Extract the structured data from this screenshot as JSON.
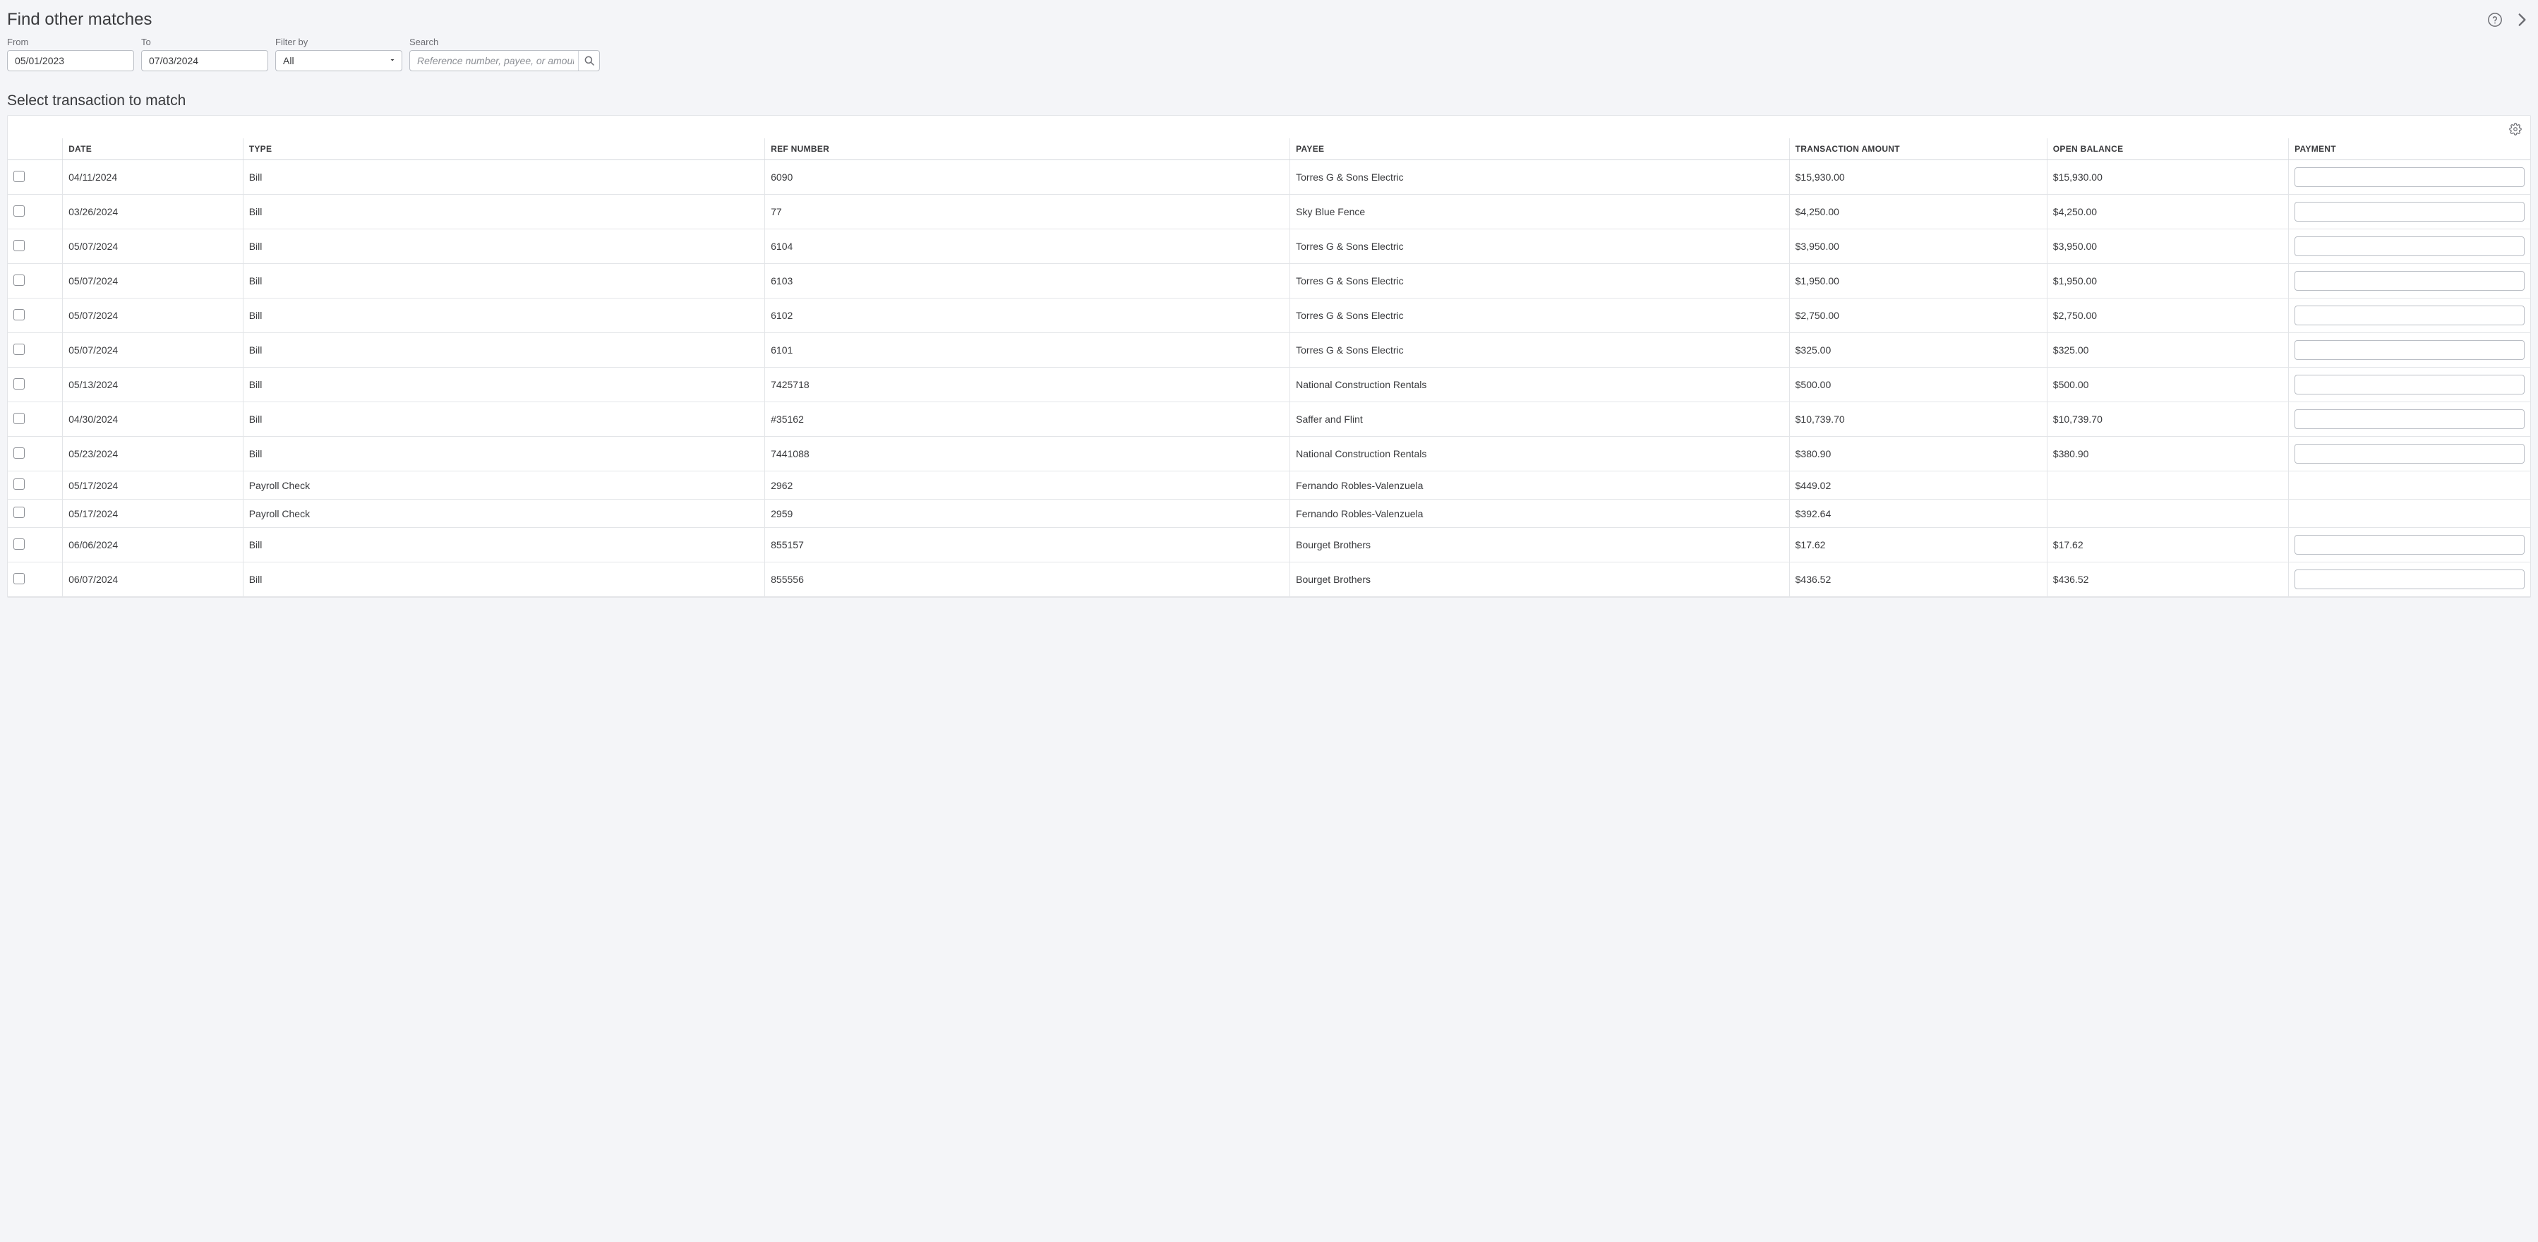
{
  "header": {
    "title": "Find other matches"
  },
  "filters": {
    "from_label": "From",
    "from_value": "05/01/2023",
    "to_label": "To",
    "to_value": "07/03/2024",
    "filter_by_label": "Filter by",
    "filter_by_value": "All",
    "search_label": "Search",
    "search_placeholder": "Reference number, payee, or amount"
  },
  "section_title": "Select transaction to match",
  "columns": {
    "date": "DATE",
    "type": "TYPE",
    "ref": "REF NUMBER",
    "payee": "PAYEE",
    "amount": "TRANSACTION AMOUNT",
    "balance": "OPEN BALANCE",
    "payment": "PAYMENT"
  },
  "rows": [
    {
      "date": "04/11/2024",
      "type": "Bill",
      "ref": "6090",
      "payee": "Torres G & Sons Electric",
      "amount": "$15,930.00",
      "balance": "$15,930.00",
      "has_payment_input": true
    },
    {
      "date": "03/26/2024",
      "type": "Bill",
      "ref": "77",
      "payee": "Sky Blue Fence",
      "amount": "$4,250.00",
      "balance": "$4,250.00",
      "has_payment_input": true
    },
    {
      "date": "05/07/2024",
      "type": "Bill",
      "ref": "6104",
      "payee": "Torres G & Sons Electric",
      "amount": "$3,950.00",
      "balance": "$3,950.00",
      "has_payment_input": true
    },
    {
      "date": "05/07/2024",
      "type": "Bill",
      "ref": "6103",
      "payee": "Torres G & Sons Electric",
      "amount": "$1,950.00",
      "balance": "$1,950.00",
      "has_payment_input": true
    },
    {
      "date": "05/07/2024",
      "type": "Bill",
      "ref": "6102",
      "payee": "Torres G & Sons Electric",
      "amount": "$2,750.00",
      "balance": "$2,750.00",
      "has_payment_input": true
    },
    {
      "date": "05/07/2024",
      "type": "Bill",
      "ref": "6101",
      "payee": "Torres G & Sons Electric",
      "amount": "$325.00",
      "balance": "$325.00",
      "has_payment_input": true
    },
    {
      "date": "05/13/2024",
      "type": "Bill",
      "ref": "7425718",
      "payee": "National Construction Rentals",
      "amount": "$500.00",
      "balance": "$500.00",
      "has_payment_input": true
    },
    {
      "date": "04/30/2024",
      "type": "Bill",
      "ref": "#35162",
      "payee": "Saffer and Flint",
      "amount": "$10,739.70",
      "balance": "$10,739.70",
      "has_payment_input": true
    },
    {
      "date": "05/23/2024",
      "type": "Bill",
      "ref": "7441088",
      "payee": "National Construction Rentals",
      "amount": "$380.90",
      "balance": "$380.90",
      "has_payment_input": true
    },
    {
      "date": "05/17/2024",
      "type": "Payroll Check",
      "ref": "2962",
      "payee": "Fernando Robles-Valenzuela",
      "amount": "$449.02",
      "balance": "",
      "has_payment_input": false
    },
    {
      "date": "05/17/2024",
      "type": "Payroll Check",
      "ref": "2959",
      "payee": "Fernando Robles-Valenzuela",
      "amount": "$392.64",
      "balance": "",
      "has_payment_input": false
    },
    {
      "date": "06/06/2024",
      "type": "Bill",
      "ref": "855157",
      "payee": "Bourget Brothers",
      "amount": "$17.62",
      "balance": "$17.62",
      "has_payment_input": true
    },
    {
      "date": "06/07/2024",
      "type": "Bill",
      "ref": "855556",
      "payee": "Bourget Brothers",
      "amount": "$436.52",
      "balance": "$436.52",
      "has_payment_input": true
    }
  ]
}
